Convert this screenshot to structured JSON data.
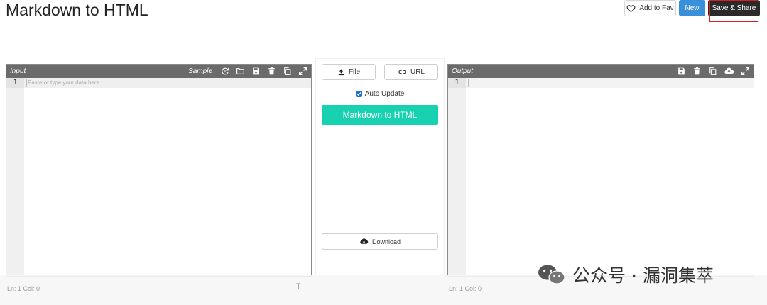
{
  "header": {
    "title": "Markdown to HTML",
    "fav_label": "Add to Fav",
    "new_label": "New",
    "share_label": "Save & Share"
  },
  "input_panel": {
    "label": "Input",
    "sample_label": "Sample",
    "line_number": "1",
    "placeholder": "Paste or type your data here....",
    "status": "Ln: 1 Col: 0"
  },
  "center": {
    "file_label": "File",
    "url_label": "URL",
    "auto_update_label": "Auto Update",
    "auto_update_checked": true,
    "convert_label": "Markdown to HTML",
    "download_label": "Download",
    "convert_color": "#17d1b0"
  },
  "output_panel": {
    "label": "Output",
    "line_number": "1",
    "status": "Ln: 1 Col: 0"
  },
  "watermark": {
    "text": "公众号 · 漏洞集萃"
  }
}
